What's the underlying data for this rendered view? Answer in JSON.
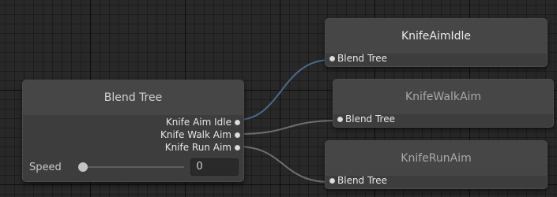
{
  "blend_tree_node": {
    "title": "Blend Tree",
    "outputs": [
      "Knife Aim Idle",
      "Knife Walk Aim",
      "Knife Run Aim"
    ],
    "parameter": {
      "label": "Speed",
      "value": "0",
      "slider_fraction": 0
    }
  },
  "motion_nodes": [
    {
      "title": "KnifeAimIdle",
      "input_label": "Blend Tree",
      "state": "selected"
    },
    {
      "title": "KnifeWalkAim",
      "input_label": "Blend Tree",
      "state": "dim"
    },
    {
      "title": "KnifeRunAim",
      "input_label": "Blend Tree",
      "state": "dim"
    }
  ],
  "colors": {
    "grid_background": "#282828",
    "node_body": "#3d3d3d",
    "node_header": "#464646",
    "highlighted_wire": "#4a6a8c",
    "wire": "#6e6e6e"
  }
}
